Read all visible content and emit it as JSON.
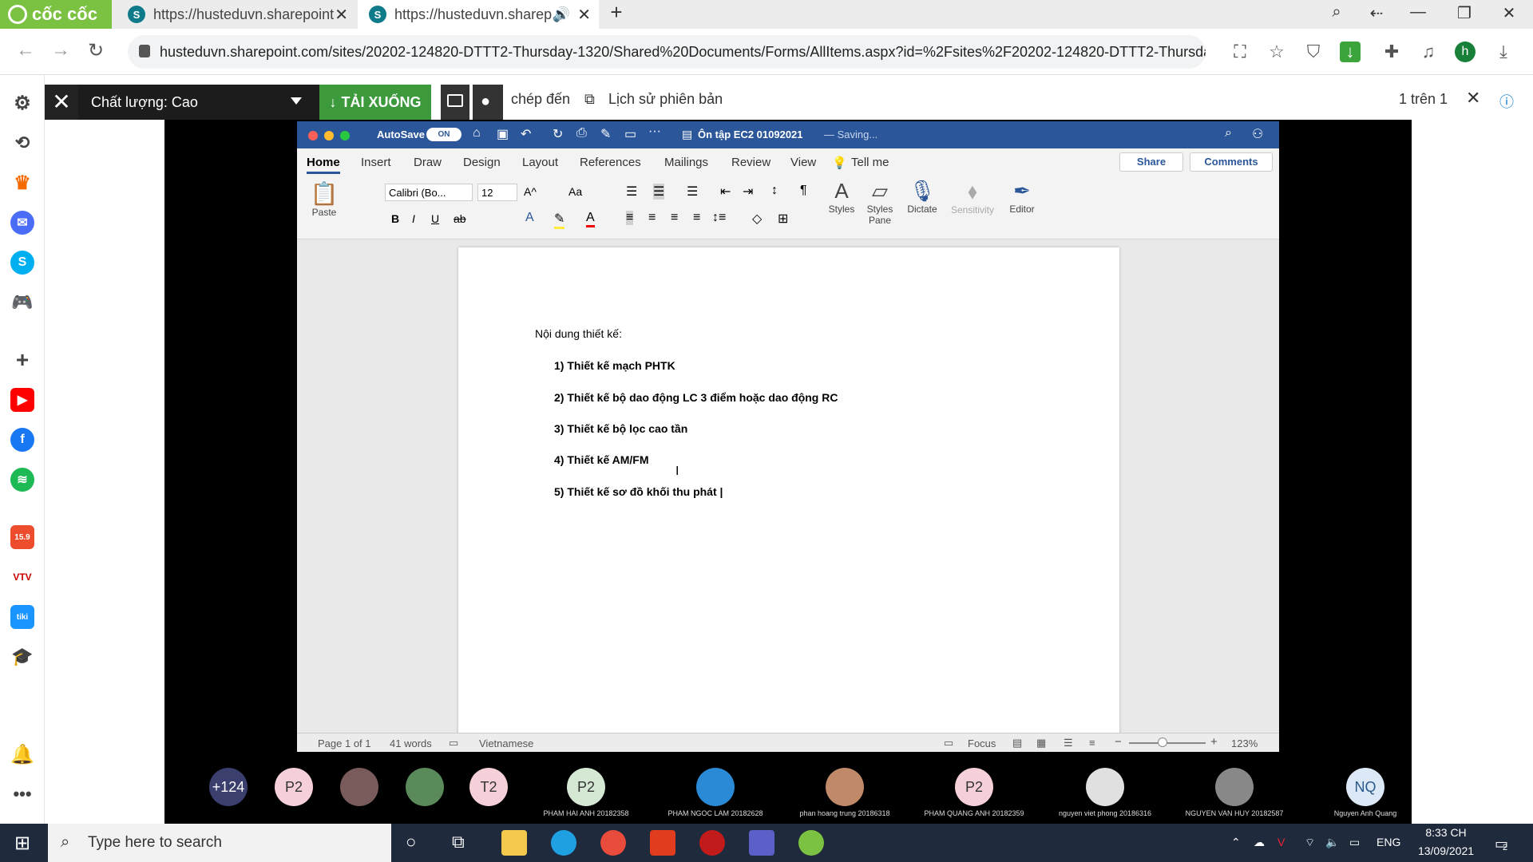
{
  "browser": {
    "logo": "cốc cốc",
    "tabs": [
      {
        "title": "https://husteduvn.sharepoint",
        "active": false
      },
      {
        "title": "https://husteduvn.sharep",
        "active": true
      }
    ],
    "url": "husteduvn.sharepoint.com/sites/20202-124820-DTTT2-Thursday-1320/Shared%20Documents/Forms/AllItems.aspx?id=%2Fsites%2F20202-124820-DTTT2-Thursday-1320...",
    "profile_initial": "h"
  },
  "viewer_bar": {
    "quality": "Chất lượng: Cao",
    "download": "TẢI XUỐNG",
    "copy_to": "chép đến",
    "version_history": "Lịch sử phiên bản",
    "page_count": "1 trên 1"
  },
  "word": {
    "autosave": "AutoSave",
    "autosave_state": "ON",
    "doc_title": "Ôn tập EC2 01092021",
    "saving": "— Saving...",
    "tabs": [
      "Home",
      "Insert",
      "Draw",
      "Design",
      "Layout",
      "References",
      "Mailings",
      "Review",
      "View",
      "Tell me"
    ],
    "share": "Share",
    "comments": "Comments",
    "font": "Calibri (Bo...",
    "font_size": "12",
    "paste": "Paste",
    "styles": "Styles",
    "styles_pane": "Styles Pane",
    "dictate": "Dictate",
    "sensitivity": "Sensitivity",
    "editor": "Editor",
    "doc_heading": "Nội dung thiết kế:",
    "doc_items": [
      "1)   Thiết kế mạch PHTK",
      "2)   Thiết kế bộ dao động LC 3 điểm hoặc dao động RC",
      "3)   Thiết kế bộ lọc cao tần",
      "4)   Thiết kế AM/FM",
      "5)   Thiết kế sơ đồ khối thu phát |"
    ],
    "status_page": "Page 1 of 1",
    "status_words": "41 words",
    "status_lang": "Vietnamese",
    "status_focus": "Focus",
    "zoom": "123%"
  },
  "participants": [
    {
      "label": "+124",
      "name": "",
      "bg": "#3b3f6e",
      "fg": "#ffffff"
    },
    {
      "label": "P2",
      "name": "",
      "bg": "#f5d0d8",
      "fg": "#333333"
    },
    {
      "label": "",
      "name": "",
      "bg": "#7a5b5b",
      "fg": "#ffffff"
    },
    {
      "label": "",
      "name": "",
      "bg": "#5a8a5a",
      "fg": "#ffffff"
    },
    {
      "label": "T2",
      "name": "",
      "bg": "#f5d0d8",
      "fg": "#333333"
    },
    {
      "label": "P2",
      "name": "PHAM HAI ANH 20182358",
      "bg": "#d5e8d4",
      "fg": "#333333"
    },
    {
      "label": "",
      "name": "PHAM NGOC LAM 20182628",
      "bg": "#2a8ad6",
      "fg": "#ffffff"
    },
    {
      "label": "",
      "name": "phan hoang trung 20186318",
      "bg": "#c08a6a",
      "fg": "#ffffff"
    },
    {
      "label": "P2",
      "name": "PHAM QUANG ANH 20182359",
      "bg": "#f5d0d8",
      "fg": "#333333"
    },
    {
      "label": "",
      "name": "nguyen viet phong 20186316",
      "bg": "#e0e0e0",
      "fg": "#333333"
    },
    {
      "label": "",
      "name": "NGUYEN VAN HUY 20182587",
      "bg": "#888888",
      "fg": "#ffffff"
    },
    {
      "label": "NQ",
      "name": "Nguyen Anh Quang",
      "bg": "#dce8f5",
      "fg": "#2a5a8a"
    }
  ],
  "taskbar": {
    "search_placeholder": "Type here to search",
    "lang": "ENG",
    "time": "8:33 CH",
    "date": "13/09/2021",
    "notif_count": "2"
  }
}
